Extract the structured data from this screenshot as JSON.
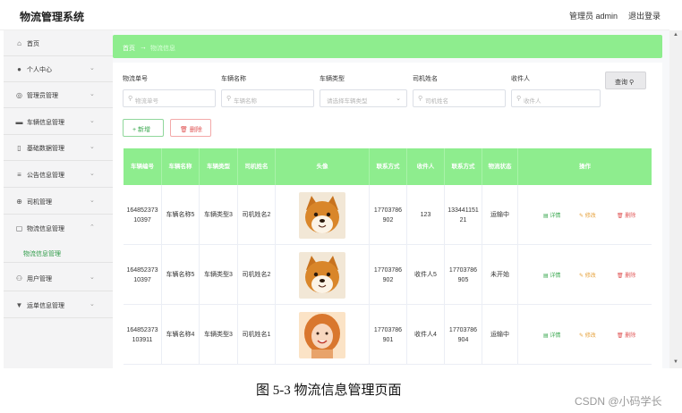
{
  "header": {
    "title": "物流管理系统",
    "admin": "管理员 admin",
    "logout": "退出登录"
  },
  "sidebar": {
    "items": [
      {
        "label": "首页",
        "icon": "home-icon",
        "chevron": false
      },
      {
        "label": "个人中心",
        "icon": "user-icon",
        "chevron": true
      },
      {
        "label": "管理员管理",
        "icon": "compass-icon",
        "chevron": true
      },
      {
        "label": "车辆信息管理",
        "icon": "monitor-icon",
        "chevron": true
      },
      {
        "label": "基础数据管理",
        "icon": "mobile-icon",
        "chevron": true
      },
      {
        "label": "公告信息管理",
        "icon": "list-icon",
        "chevron": true
      },
      {
        "label": "司机管理",
        "icon": "globe-icon",
        "chevron": true
      },
      {
        "label": "物流信息管理",
        "icon": "message-icon",
        "chevron": true
      },
      {
        "label": "用户管理",
        "icon": "users-icon",
        "chevron": true
      },
      {
        "label": "运单信息管理",
        "icon": "tag-icon",
        "chevron": true
      }
    ],
    "active_sub": "物流信息管理"
  },
  "breadcrumb": {
    "home": "首页",
    "separator": "→",
    "current": "物流信息"
  },
  "search": {
    "fields": [
      {
        "label": "物流单号",
        "placeholder": "物流单号",
        "type": "input"
      },
      {
        "label": "车辆名称",
        "placeholder": "车辆名称",
        "type": "input"
      },
      {
        "label": "车辆类型",
        "placeholder": "请选择车辆类型",
        "type": "select"
      },
      {
        "label": "司机姓名",
        "placeholder": "司机姓名",
        "type": "input"
      },
      {
        "label": "收件人",
        "placeholder": "收件人",
        "type": "input"
      }
    ],
    "query_button": "查询 ⚲"
  },
  "actions": {
    "add": "+ 新增",
    "delete": "🗑 删除"
  },
  "table": {
    "columns": [
      "车辆编号",
      "车辆名称",
      "车辆类型",
      "司机姓名",
      "头像",
      "联系方式",
      "收件人",
      "联系方式",
      "物流状态",
      "操作"
    ],
    "rows": [
      {
        "vehicle_no": "16485237310397",
        "vehicle_name": "车辆名称5",
        "vehicle_type": "车辆类型3",
        "driver": "司机姓名2",
        "avatar": "shiba",
        "phone": "17703786902",
        "receiver": "123",
        "receiver_phone": "13344115121",
        "status": "运输中"
      },
      {
        "vehicle_no": "16485237310397",
        "vehicle_name": "车辆名称5",
        "vehicle_type": "车辆类型3",
        "driver": "司机姓名2",
        "avatar": "shiba",
        "phone": "17703786902",
        "receiver": "收件人5",
        "receiver_phone": "17703786905",
        "status": "未开始"
      },
      {
        "vehicle_no": "164852373103911",
        "vehicle_name": "车辆名称4",
        "vehicle_type": "车辆类型3",
        "driver": "司机姓名1",
        "avatar": "woman",
        "phone": "17703786901",
        "receiver": "收件人4",
        "receiver_phone": "17703786904",
        "status": "运输中"
      }
    ],
    "ops": {
      "detail": "详情",
      "edit": "修改",
      "delete": "删除"
    }
  },
  "caption": "图 5-3 物流信息管理页面",
  "watermark": "CSDN @小码学长",
  "colors": {
    "accent": "#8eed8e",
    "sidebar_bg": "#f4f4f5",
    "active_text": "#2e9b48"
  }
}
